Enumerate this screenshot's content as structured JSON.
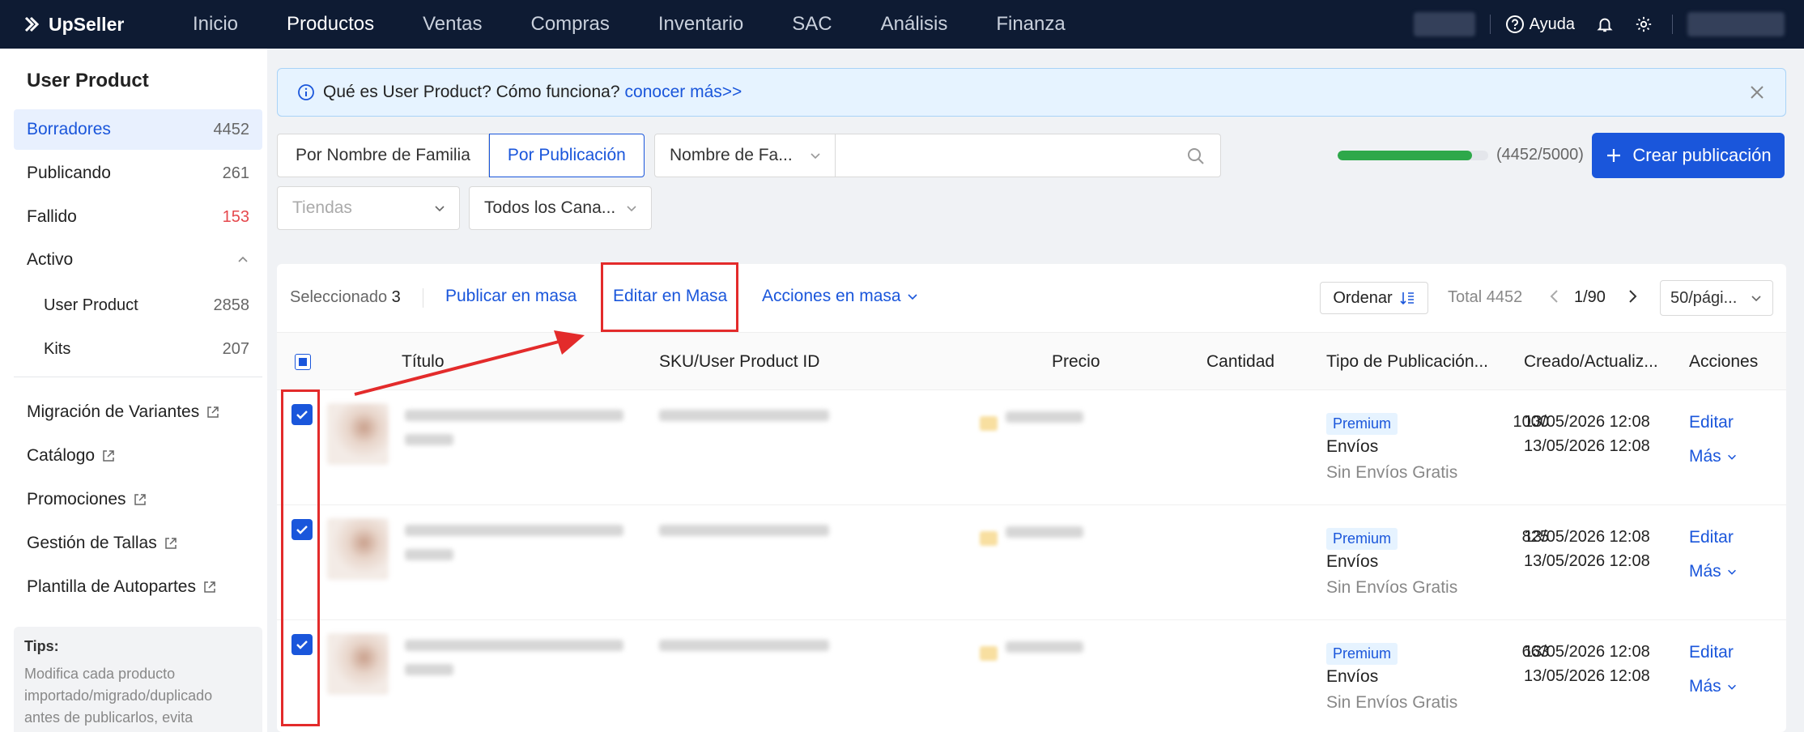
{
  "topnav": {
    "brand": "UpSeller",
    "items": [
      "Inicio",
      "Productos",
      "Ventas",
      "Compras",
      "Inventario",
      "SAC",
      "Análisis",
      "Finanza"
    ],
    "active": "Productos",
    "help_label": "Ayuda",
    "icons": [
      "help-circle-icon",
      "bell-icon",
      "gear-icon"
    ]
  },
  "sidebar": {
    "title": "User Product",
    "items": [
      {
        "label": "Borradores",
        "count": "4452"
      },
      {
        "label": "Publicando",
        "count": "261"
      },
      {
        "label": "Fallido",
        "count": "153"
      },
      {
        "label": "Activo",
        "count": ""
      },
      {
        "label": "User Product",
        "count": "2858"
      },
      {
        "label": "Kits",
        "count": "207"
      }
    ],
    "links": [
      "Migración de Variantes",
      "Catálogo",
      "Promociones",
      "Gestión de Tallas",
      "Plantilla de Autopartes"
    ],
    "tips_title": "Tips:",
    "tips_text": "Modifica cada producto importado/migrado/duplicado antes de publicarlos, evita sanciones por"
  },
  "banner": {
    "text": "Qué es User Product? Cómo funciona?",
    "link": "conocer más>>"
  },
  "filters": {
    "seg_family": "Por Nombre de Familia",
    "seg_publication": "Por Publicación",
    "field_select": "Nombre de Fa...",
    "search_placeholder": "",
    "stores_placeholder": "Tiendas",
    "channels": "Todos los Cana..."
  },
  "quota": {
    "text": "(4452/5000)",
    "used": 4452,
    "max": 5000
  },
  "create_button": "Crear publicación",
  "toolbar": {
    "selected_label": "Seleccionado",
    "selected_count": "3",
    "bulk_publish": "Publicar en masa",
    "bulk_edit": "Editar en Masa",
    "bulk_actions": "Acciones en masa",
    "order": "Ordenar",
    "total": "Total 4452",
    "page": "1/90",
    "per_page": "50/pági..."
  },
  "columns": [
    "Título",
    "SKU/User Product ID",
    "Precio",
    "Cantidad",
    "Tipo de Publicación...",
    "Creado/Actualiz...",
    "Acciones"
  ],
  "rows": [
    {
      "qty": "1000",
      "badge": "Premium",
      "ship": "Envíos",
      "ship2": "Sin Envíos Gratis",
      "created": "13/05/2026 12:08",
      "updated": "13/05/2026 12:08",
      "edit": "Editar",
      "more": "Más"
    },
    {
      "qty": "825",
      "badge": "Premium",
      "ship": "Envíos",
      "ship2": "Sin Envíos Gratis",
      "created": "13/05/2026 12:08",
      "updated": "13/05/2026 12:08",
      "edit": "Editar",
      "more": "Más"
    },
    {
      "qty": "663",
      "badge": "Premium",
      "ship": "Envíos",
      "ship2": "Sin Envíos Gratis",
      "created": "13/05/2026 12:08",
      "updated": "13/05/2026 12:08",
      "edit": "Editar",
      "more": "Más"
    }
  ],
  "colors": {
    "nav_bg": "#0e1b33",
    "primary": "#1a56db",
    "annotation": "#e32b2b",
    "progress": "#2ea84a",
    "error": "#e5484d"
  }
}
